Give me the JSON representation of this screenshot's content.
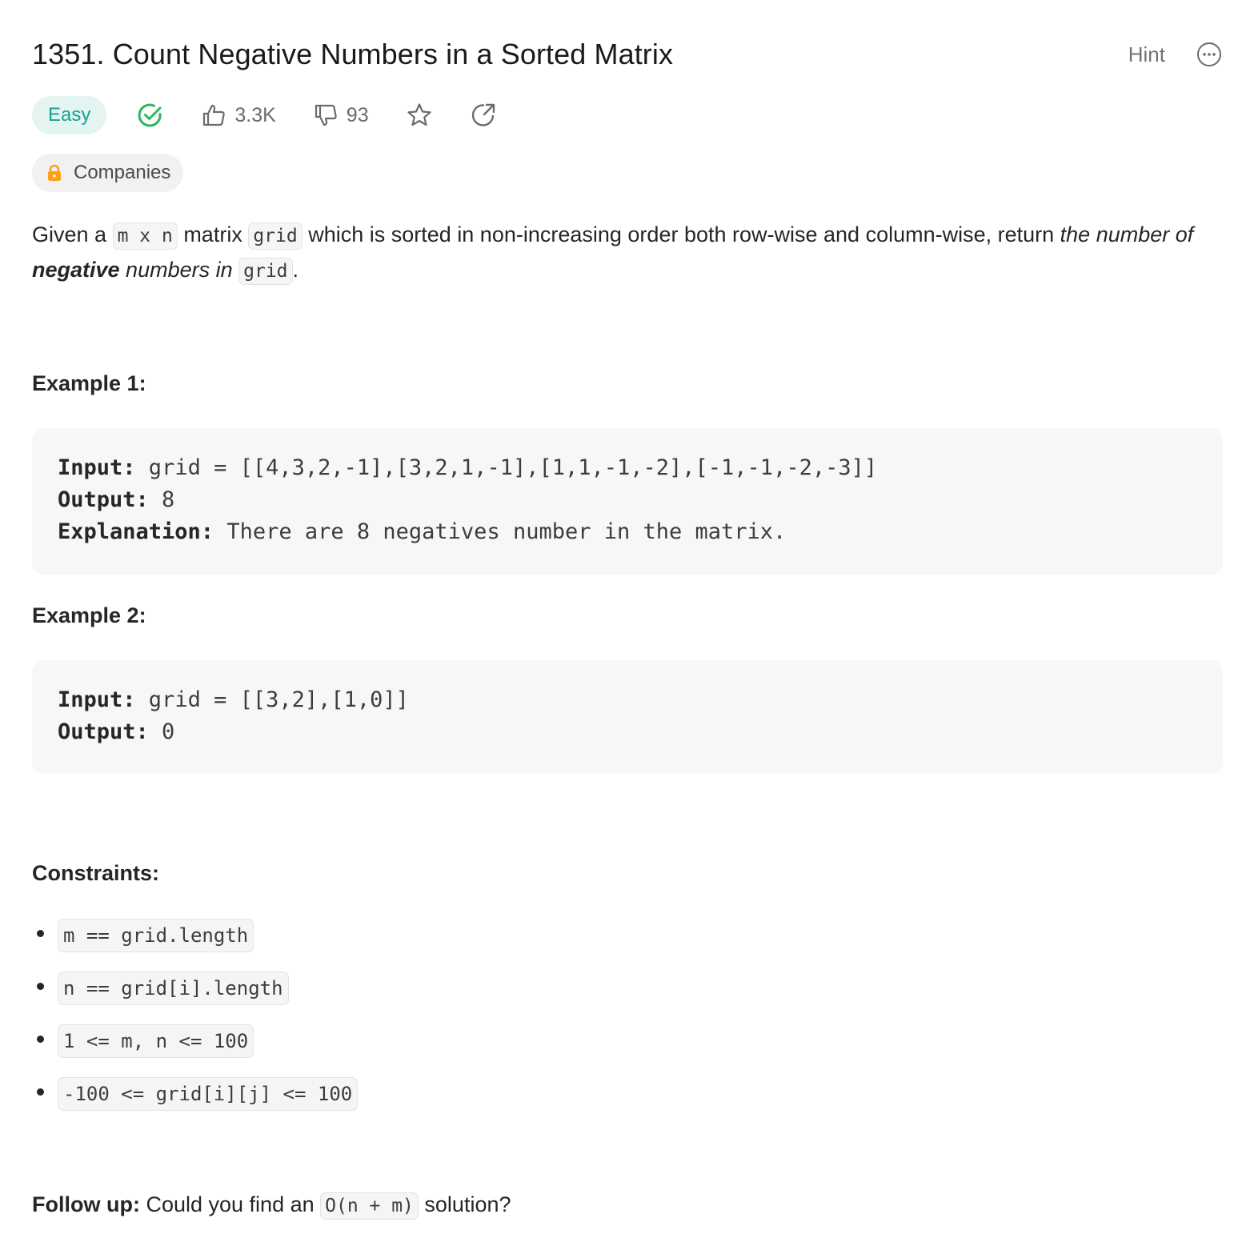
{
  "problem": {
    "title": "1351. Count Negative Numbers in a Sorted Matrix",
    "hint_label": "Hint",
    "difficulty": "Easy",
    "likes": "3.3K",
    "dislikes": "93",
    "companies_label": "Companies"
  },
  "description": {
    "p1": "Given a ",
    "c1": "m x n",
    "p2": " matrix ",
    "c2": "grid",
    "p3": " which is sorted in non-increasing order both row-wise and column-wise, return ",
    "em1": "the number of ",
    "strong1": "negative",
    "em2": " numbers in ",
    "c3": "grid",
    "p4": "."
  },
  "examples": [
    {
      "heading": "Example 1:",
      "input_label": "Input:",
      "input_value": " grid = [[4,3,2,-1],[3,2,1,-1],[1,1,-1,-2],[-1,-1,-2,-3]]",
      "output_label": "Output:",
      "output_value": " 8",
      "explanation_label": "Explanation:",
      "explanation_value": " There are 8 negatives number in the matrix."
    },
    {
      "heading": "Example 2:",
      "input_label": "Input:",
      "input_value": " grid = [[3,2],[1,0]]",
      "output_label": "Output:",
      "output_value": " 0"
    }
  ],
  "constraints": {
    "heading": "Constraints:",
    "items": [
      "m == grid.length",
      "n == grid[i].length",
      "1 <= m, n <= 100",
      "-100 <= grid[i][j] <= 100"
    ]
  },
  "followup": {
    "label": "Follow up:",
    "p1": " Could you find an ",
    "code": "O(n + m)",
    "p2": " solution?"
  },
  "colors": {
    "easy_text": "#16a394",
    "easy_bg": "#e4f4f1",
    "solved_check": "#2db55d",
    "lock": "#ffa116"
  },
  "icons": {
    "solved": "check-circle-icon",
    "like": "thumbs-up-icon",
    "dislike": "thumbs-down-icon",
    "favorite": "star-icon",
    "share": "share-icon",
    "more": "more-icon",
    "lock": "lock-icon"
  }
}
